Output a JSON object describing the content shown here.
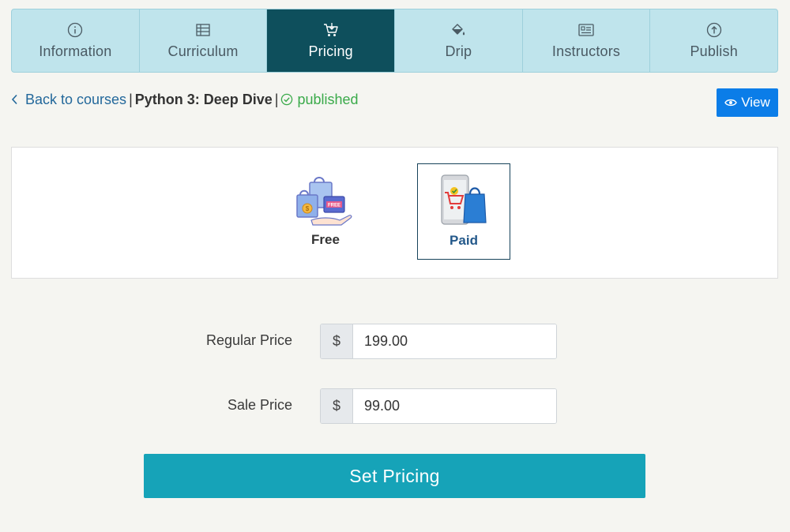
{
  "tabs": [
    {
      "label": "Information",
      "icon": "info-circle-icon",
      "active": false
    },
    {
      "label": "Curriculum",
      "icon": "list-table-icon",
      "active": false
    },
    {
      "label": "Pricing",
      "icon": "cart-icon",
      "active": true
    },
    {
      "label": "Drip",
      "icon": "paint-bucket-icon",
      "active": false
    },
    {
      "label": "Instructors",
      "icon": "id-card-icon",
      "active": false
    },
    {
      "label": "Publish",
      "icon": "upload-circle-icon",
      "active": false
    }
  ],
  "breadcrumb": {
    "back_label": "Back to courses",
    "separator": "|",
    "course_title": "Python 3: Deep Dive",
    "status": "published"
  },
  "view_button": {
    "label": "View"
  },
  "pricing_type": {
    "options": [
      {
        "label": "Free",
        "icon": "free-shopping-bags-icon",
        "selected": false
      },
      {
        "label": "Paid",
        "icon": "paid-cart-phone-icon",
        "selected": true
      }
    ]
  },
  "form": {
    "regular_price": {
      "label": "Regular Price",
      "prefix": "$",
      "value": "199.00"
    },
    "sale_price": {
      "label": "Sale Price",
      "prefix": "$",
      "value": "99.00"
    }
  },
  "submit_button": {
    "label": "Set Pricing"
  },
  "colors": {
    "active_tab": "#0e4f5c",
    "tab_bg": "#bfe4ec",
    "primary_button": "#16a3b8",
    "view_button": "#0b7de8",
    "published_status": "#3aaa4a",
    "link": "#23689b"
  }
}
